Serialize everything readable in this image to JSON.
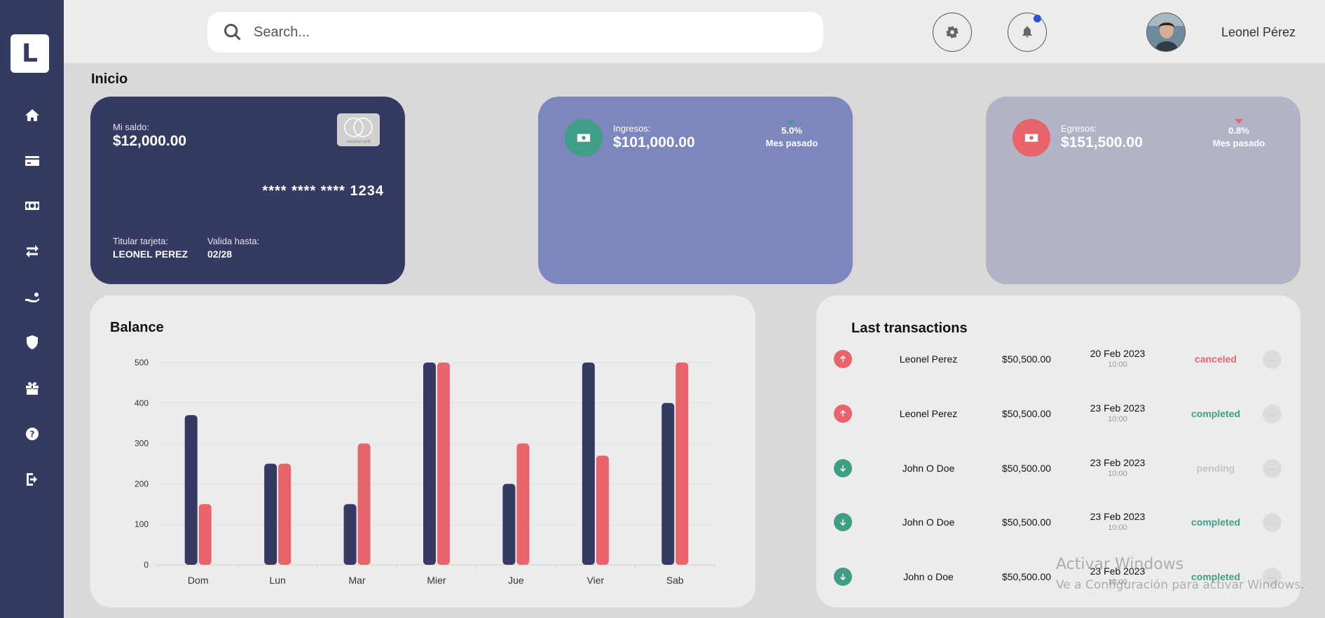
{
  "sidebar": {
    "logo": "L",
    "items": [
      {
        "icon": "home-icon"
      },
      {
        "icon": "credit-card-icon"
      },
      {
        "icon": "money-icon"
      },
      {
        "icon": "transfer-icon"
      },
      {
        "icon": "hand-coin-icon"
      },
      {
        "icon": "shield-icon"
      },
      {
        "icon": "gift-icon"
      },
      {
        "icon": "help-icon"
      },
      {
        "icon": "logout-icon"
      }
    ]
  },
  "header": {
    "search_placeholder": "Search...",
    "username": "Leonel Pérez"
  },
  "page": {
    "title": "Inicio"
  },
  "cards": {
    "balance": {
      "label": "Mi saldo:",
      "amount": "$12,000.00",
      "brand": "mastercard",
      "number_mask": "**** **** ****",
      "number_last": "1234",
      "holder_label": "Titular tarjeta:",
      "holder": "LEONEL PEREZ",
      "valid_label": "Valida hasta:",
      "valid": "02/28"
    },
    "income": {
      "label": "Ingresos:",
      "amount": "$101,000.00",
      "change": "5.0%",
      "period": "Mes pasado",
      "trend": "up"
    },
    "expense": {
      "label": "Egresos:",
      "amount": "$151,500.00",
      "change": "0.8%",
      "period": "Mes pasado",
      "trend": "down"
    }
  },
  "colors": {
    "navy": "#343a62",
    "red": "#e8646a",
    "green": "#3f9e86",
    "periwinkle": "#7c87bd",
    "grey_card": "#b1b4c6"
  },
  "balance": {
    "title": "Balance"
  },
  "chart_data": {
    "type": "bar",
    "title": "Balance",
    "categories": [
      "Dom",
      "Lun",
      "Mar",
      "Mier",
      "Jue",
      "Vier",
      "Sab"
    ],
    "series": [
      {
        "color": "#343a62",
        "values": [
          370,
          250,
          150,
          500,
          200,
          500,
          400
        ]
      },
      {
        "color": "#e8646a",
        "values": [
          150,
          250,
          300,
          500,
          300,
          270,
          500
        ]
      }
    ],
    "yticks": [
      0,
      100,
      200,
      300,
      400,
      500
    ],
    "ylim": [
      0,
      500
    ],
    "grid": true
  },
  "transactions": {
    "title": "Last transactions",
    "rows": [
      {
        "direction": "up",
        "name": "Leonel Perez",
        "amount": "$50,500.00",
        "date": "20 Feb 2023",
        "time": "10:00",
        "status": "canceled"
      },
      {
        "direction": "up",
        "name": "Leonel Perez",
        "amount": "$50,500.00",
        "date": "23 Feb 2023",
        "time": "10:00",
        "status": "completed"
      },
      {
        "direction": "down",
        "name": "John O Doe",
        "amount": "$50,500.00",
        "date": "23 Feb 2023",
        "time": "10:00",
        "status": "pending"
      },
      {
        "direction": "down",
        "name": "John O Doe",
        "amount": "$50,500.00",
        "date": "23 Feb 2023",
        "time": "10:00",
        "status": "completed"
      },
      {
        "direction": "down",
        "name": "John o Doe",
        "amount": "$50,500.00",
        "date": "23 Feb 2023",
        "time": "10:00",
        "status": "completed"
      }
    ],
    "more_label": "···"
  },
  "watermark": {
    "line1": "Activar Windows",
    "line2": "Ve a Configuración para activar Windows."
  }
}
